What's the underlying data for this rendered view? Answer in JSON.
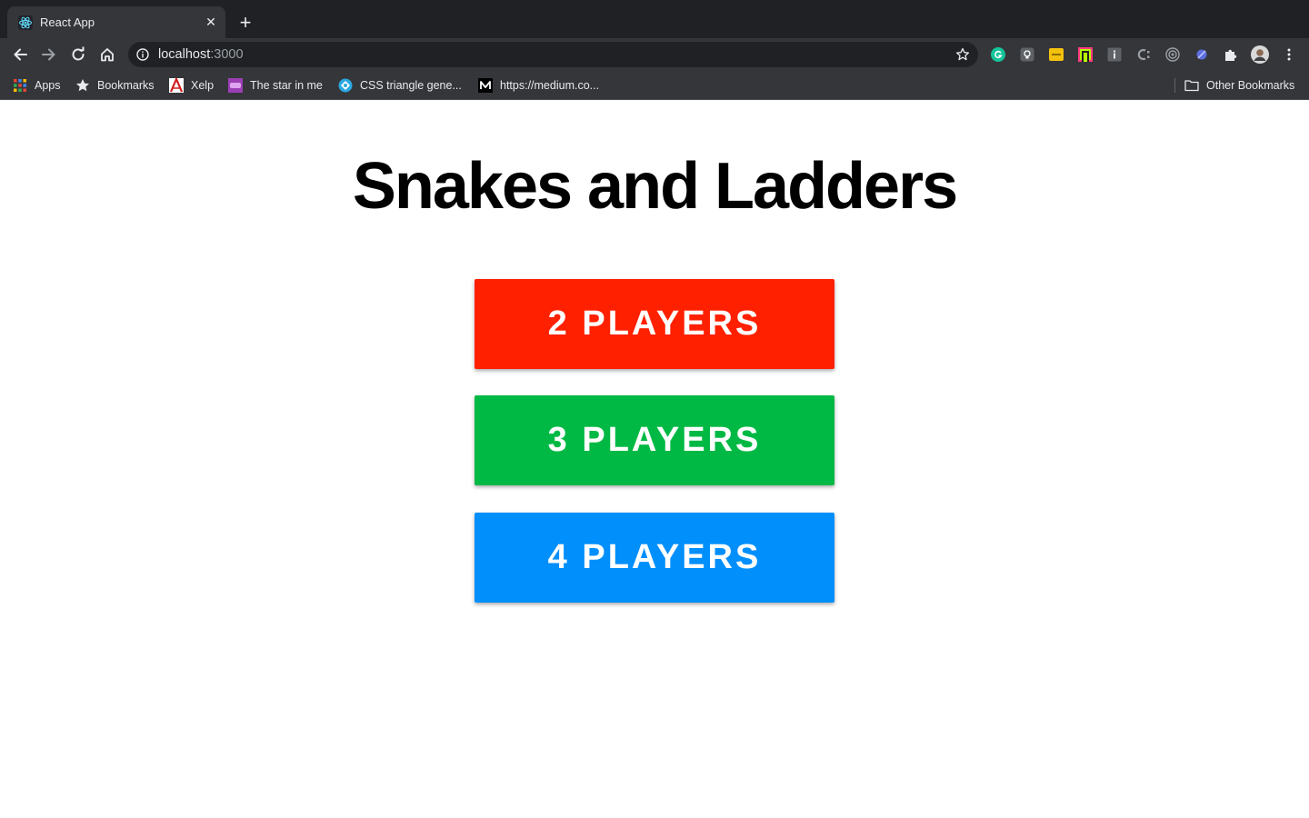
{
  "browser": {
    "tab": {
      "title": "React App",
      "close_glyph": "✕",
      "favicon": "react-icon"
    },
    "new_tab_glyph": "+",
    "address": {
      "host": "localhost",
      "port": ":3000"
    },
    "bookmarks": [
      {
        "label": "Apps",
        "icon": "apps-grid-icon"
      },
      {
        "label": "Bookmarks",
        "icon": "star-icon"
      },
      {
        "label": "Xelp",
        "icon": "xelp-icon"
      },
      {
        "label": "The star in me",
        "icon": "me-icon"
      },
      {
        "label": "CSS triangle gene...",
        "icon": "css-triangle-icon"
      },
      {
        "label": "https://medium.co...",
        "icon": "medium-icon"
      }
    ],
    "other_bookmarks": "Other Bookmarks"
  },
  "game": {
    "title": "Snakes and Ladders",
    "buttons": [
      {
        "label": "2 PLAYERS",
        "color": "#ff2000"
      },
      {
        "label": "3 PLAYERS",
        "color": "#00b944"
      },
      {
        "label": "4 PLAYERS",
        "color": "#008ffb"
      }
    ]
  }
}
